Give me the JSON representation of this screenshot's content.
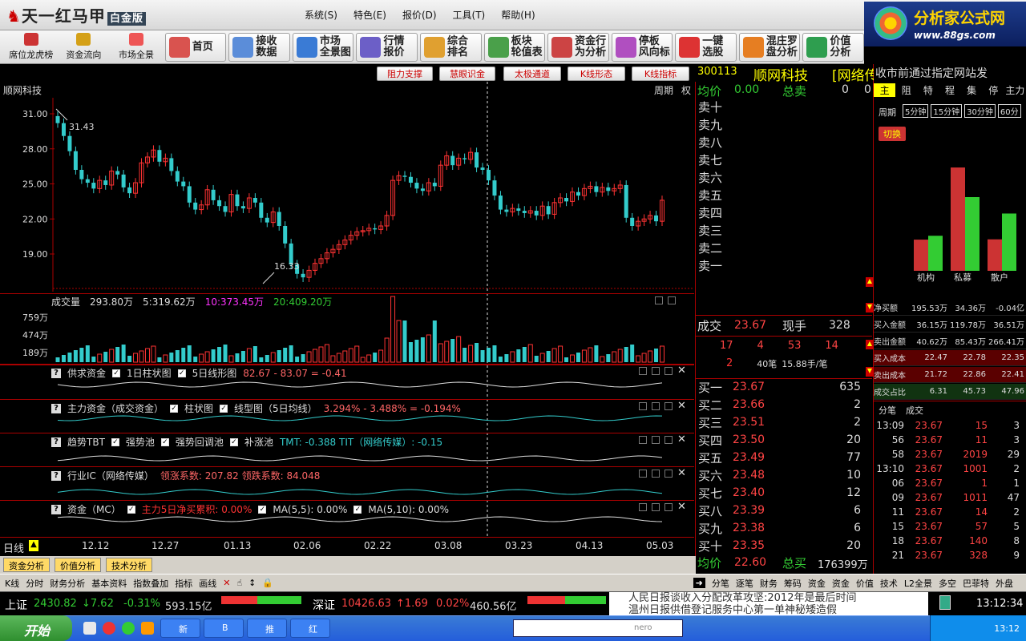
{
  "app": {
    "title": "天一红马甲",
    "edition": "白金版"
  },
  "menu": [
    "系统(S)",
    "特色(E)",
    "报价(D)",
    "工具(T)",
    "帮助(H)"
  ],
  "brand": {
    "name": "分析家公式网",
    "url": "www.88gs.com"
  },
  "toolbar_small": [
    "席位龙虎榜",
    "资金流向",
    "市场全景"
  ],
  "toolbar_big": [
    {
      "label": "首页",
      "color": "#d9534f"
    },
    {
      "label": "接收\n数据",
      "color": "#5b8dd9"
    },
    {
      "label": "市场\n全景图",
      "color": "#3a7bd5"
    },
    {
      "label": "行情\n报价",
      "color": "#6c5fc7"
    },
    {
      "label": "综合\n排名",
      "color": "#e0a030"
    },
    {
      "label": "板块\n轮值表",
      "color": "#4aa04a"
    },
    {
      "label": "资金行\n为分析",
      "color": "#c44"
    },
    {
      "label": "停板\n风向标",
      "color": "#b04fc0"
    },
    {
      "label": "一键\n选股",
      "color": "#d33"
    },
    {
      "label": "混庄罗\n盘分析",
      "color": "#e67e22"
    },
    {
      "label": "价值\n分析",
      "color": "#2e9e4f"
    }
  ],
  "subbuttons": [
    "阻力支撑",
    "慧眼识金",
    "太极通道",
    "K线形态",
    "K线指标"
  ],
  "chart": {
    "stock_name": "顺网科技",
    "period_label": "周期",
    "right_label": "权",
    "y_ticks": [
      "31.00",
      "28.00",
      "25.00",
      "22.00",
      "19.00"
    ],
    "high_label": "31.43",
    "low_label": "16.33",
    "dates": [
      "12.12",
      "12.27",
      "01.13",
      "02.06",
      "02.22",
      "03.08",
      "03.23",
      "04.13",
      "05.03"
    ],
    "day_label": "日线"
  },
  "chart_data": {
    "type": "candlestick",
    "y_ticks": [
      31,
      28,
      25,
      22,
      19
    ],
    "ylim": [
      16,
      32
    ],
    "high": 31.43,
    "low": 16.33,
    "closes": [
      30.2,
      29.1,
      27.8,
      26.2,
      25.4,
      25.1,
      24.6,
      25.3,
      24.9,
      26.1,
      25.8,
      24.7,
      24.2,
      25.1,
      26.8,
      27.3,
      27.9,
      26.9,
      27.2,
      26.1,
      25.2,
      24.8,
      23.4,
      22.8,
      23.2,
      24.5,
      23.6,
      23.1,
      22.6,
      24.1,
      23.1,
      22.9,
      23.8,
      23.4,
      22.1,
      21.7,
      22.6,
      21.4,
      19.9,
      18.1,
      17.3,
      17.0,
      17.6,
      18.2,
      18.6,
      19.1,
      19.4,
      19.8,
      20.2,
      20.6,
      20.9,
      21.0,
      21.2,
      21.1,
      21.4,
      22.3,
      25.3,
      25.7,
      25.6,
      25.1,
      24.6,
      24.4,
      25.1,
      24.8,
      26.6,
      27.4,
      26.6,
      27.2,
      27.1,
      27.7,
      26.4,
      26.2,
      25.3,
      24.0,
      22.8,
      22.6,
      22.9,
      22.7,
      22.5,
      22.7,
      22.3,
      23.1,
      22.4,
      23.4,
      23.8,
      23.5,
      24.3,
      24.0,
      24.6,
      24.8,
      24.3,
      24.7,
      24.4,
      24.6,
      24.9,
      22.1,
      21.4,
      21.8,
      22.0,
      22.3,
      21.8,
      23.6
    ],
    "volume": {
      "label": "成交量",
      "value": "293.80万",
      "ma5": "5:319.62万",
      "ma10": "10:373.45万",
      "ma20": "20:409.20万",
      "y_ticks": [
        "759万",
        "474万",
        "189万"
      ]
    }
  },
  "indicators": [
    {
      "name": "供求资金",
      "opt1": "1日柱状图",
      "opt2": "5日线形图",
      "formula": "82.67 - 83.07 = -0.41"
    },
    {
      "name": "主力资金（成交资金）",
      "opt1": "柱状图",
      "opt2": "线型图（5日均线）",
      "formula": "3.294% - 3.488% = -0.194%"
    },
    {
      "name": "趋势TBT",
      "opt1": "强势池",
      "opt2": "强势回调池",
      "opt3": "补涨池",
      "formula": "TMT: -0.388 TIT（网络传媒）: -0.15"
    },
    {
      "name": "行业IC（网络传媒）",
      "formula": "领涨系数: 207.82 领跌系数: 84.048"
    },
    {
      "name": "资金（MC）",
      "opt1": "主力5日净买累积: 0.00%",
      "opt2": "MA(5,5): 0.00%",
      "opt3": "MA(5,10): 0.00%"
    }
  ],
  "bottom_buttons": [
    "资金分析",
    "价值分析",
    "技术分析"
  ],
  "quote": {
    "code": "300113",
    "name": "顺网科技",
    "sector": "[网络传媒]",
    "marquee": "收市前通过指定网站发",
    "avg_label": "均价",
    "avg_value": "0.00",
    "total_sell_label": "总卖",
    "total_sell": "0",
    "total_sell2": "0",
    "sell_levels": [
      "卖十",
      "卖九",
      "卖八",
      "卖七",
      "卖六",
      "卖五",
      "卖四",
      "卖三",
      "卖二",
      "卖一"
    ],
    "trade_label": "成交",
    "trade_price": "23.67",
    "now_label": "现手",
    "now_vol": "328",
    "stats1": [
      "17",
      "4",
      "53",
      "14"
    ],
    "stats2": [
      "2",
      "40笔",
      "15.88手/笔"
    ],
    "buy_levels": [
      {
        "k": "买一",
        "p": "23.67",
        "v": "635"
      },
      {
        "k": "买二",
        "p": "23.66",
        "v": "2"
      },
      {
        "k": "买三",
        "p": "23.51",
        "v": "2"
      },
      {
        "k": "买四",
        "p": "23.50",
        "v": "20"
      },
      {
        "k": "买五",
        "p": "23.49",
        "v": "77"
      },
      {
        "k": "买六",
        "p": "23.48",
        "v": "10"
      },
      {
        "k": "买七",
        "p": "23.40",
        "v": "12"
      },
      {
        "k": "买八",
        "p": "23.39",
        "v": "6"
      },
      {
        "k": "买九",
        "p": "23.38",
        "v": "6"
      },
      {
        "k": "买十",
        "p": "23.35",
        "v": "20"
      }
    ],
    "avg2_label": "均价",
    "avg2": "22.60",
    "total_buy_label": "总买",
    "total_buy": "176399万"
  },
  "info": {
    "tabs": [
      "主",
      "阻",
      "特",
      "程",
      "集",
      "停",
      "主力"
    ],
    "period_label": "周期",
    "periods": [
      "5分钟",
      "15分钟",
      "30分钟",
      "60分"
    ],
    "switch_label": "切换",
    "bars": {
      "labels": [
        "机构",
        "私募",
        "散户"
      ],
      "buy": [
        36.15,
        119.78,
        36.51
      ],
      "sell": [
        40.62,
        85.43,
        66.41
      ]
    },
    "rows": [
      {
        "k": "净买额",
        "v": [
          "195.53万",
          "34.36万",
          "-0.04亿"
        ]
      },
      {
        "k": "买入金额",
        "v": [
          "36.15万",
          "119.78万",
          "36.51万"
        ]
      },
      {
        "k": "卖出金额",
        "v": [
          "40.62万",
          "85.43万",
          "266.41万"
        ]
      },
      {
        "k": "买入成本",
        "v": [
          "22.47",
          "22.78",
          "22.35"
        ]
      },
      {
        "k": "卖出成本",
        "v": [
          "21.72",
          "22.86",
          "22.41"
        ]
      },
      {
        "k": "成交占比",
        "v": [
          "6.31",
          "45.73",
          "47.96"
        ]
      }
    ],
    "trade_tabs": [
      "分笔",
      "成交"
    ],
    "trades": [
      {
        "t": "13:09",
        "p": "23.67",
        "v": "15",
        "n": "3"
      },
      {
        "t": "56",
        "p": "23.67",
        "v": "11",
        "n": "3"
      },
      {
        "t": "58",
        "p": "23.67",
        "v": "2019",
        "n": "29"
      },
      {
        "t": "13:10",
        "p": "23.67",
        "v": "1001",
        "n": "2"
      },
      {
        "t": "06",
        "p": "23.67",
        "v": "1",
        "n": "1"
      },
      {
        "t": "09",
        "p": "23.67",
        "v": "1011",
        "n": "47"
      },
      {
        "t": "11",
        "p": "23.67",
        "v": "14",
        "n": "2"
      },
      {
        "t": "15",
        "p": "23.67",
        "v": "57",
        "n": "5"
      },
      {
        "t": "18",
        "p": "23.67",
        "v": "140",
        "n": "8"
      },
      {
        "t": "21",
        "p": "23.67",
        "v": "328",
        "n": "9"
      }
    ]
  },
  "funcbar_left": [
    "K线",
    "分时",
    "财务分析",
    "基本资料",
    "指数叠加",
    "指标",
    "画线"
  ],
  "funcbar_right": [
    "分笔",
    "逐笔",
    "财务",
    "筹码",
    "资金",
    "资金",
    "价值",
    "技术",
    "L2全景",
    "多空",
    "巴菲特",
    "外盘"
  ],
  "status": {
    "sh_label": "上证",
    "sh_val": "2430.82",
    "sh_chg": "7.62",
    "sh_pct": "-0.31%",
    "sh_amt": "593.15亿",
    "sz_label": "深证",
    "sz_val": "10426.63",
    "sz_chg": "1.69",
    "sz_pct": "0.02%",
    "sz_amt": "460.56亿",
    "news1": "人民日报谈收入分配改革攻坚:2012年是最后时间",
    "news2": "温州日报供借登记服务中心第一单神秘矮造假",
    "time": "13:12:34"
  },
  "taskbar": {
    "start": "开始",
    "tasks": [
      "新",
      "B",
      "推",
      "红"
    ],
    "clock": "13:12"
  }
}
